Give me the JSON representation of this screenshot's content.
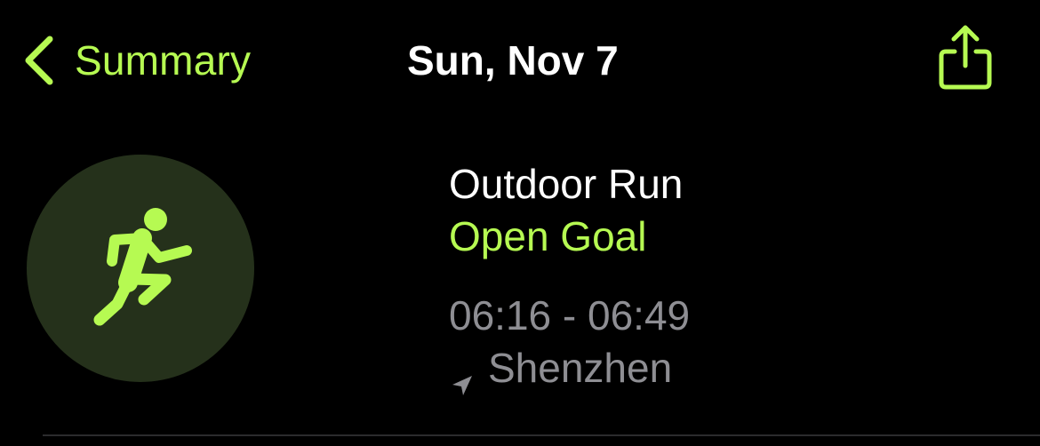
{
  "nav": {
    "back_label": "Summary",
    "title": "Sun, Nov 7"
  },
  "workout": {
    "type": "Outdoor Run",
    "goal": "Open Goal",
    "time_range": "06:16 - 06:49",
    "location": "Shenzhen"
  },
  "icons": {
    "back": "chevron-left-icon",
    "share": "share-icon",
    "workout": "running-figure-icon",
    "location": "location-arrow-icon"
  },
  "colors": {
    "accent": "#b6fa52",
    "background": "#000000",
    "secondary_text": "#8e8e93",
    "icon_circle": "#25311b"
  }
}
